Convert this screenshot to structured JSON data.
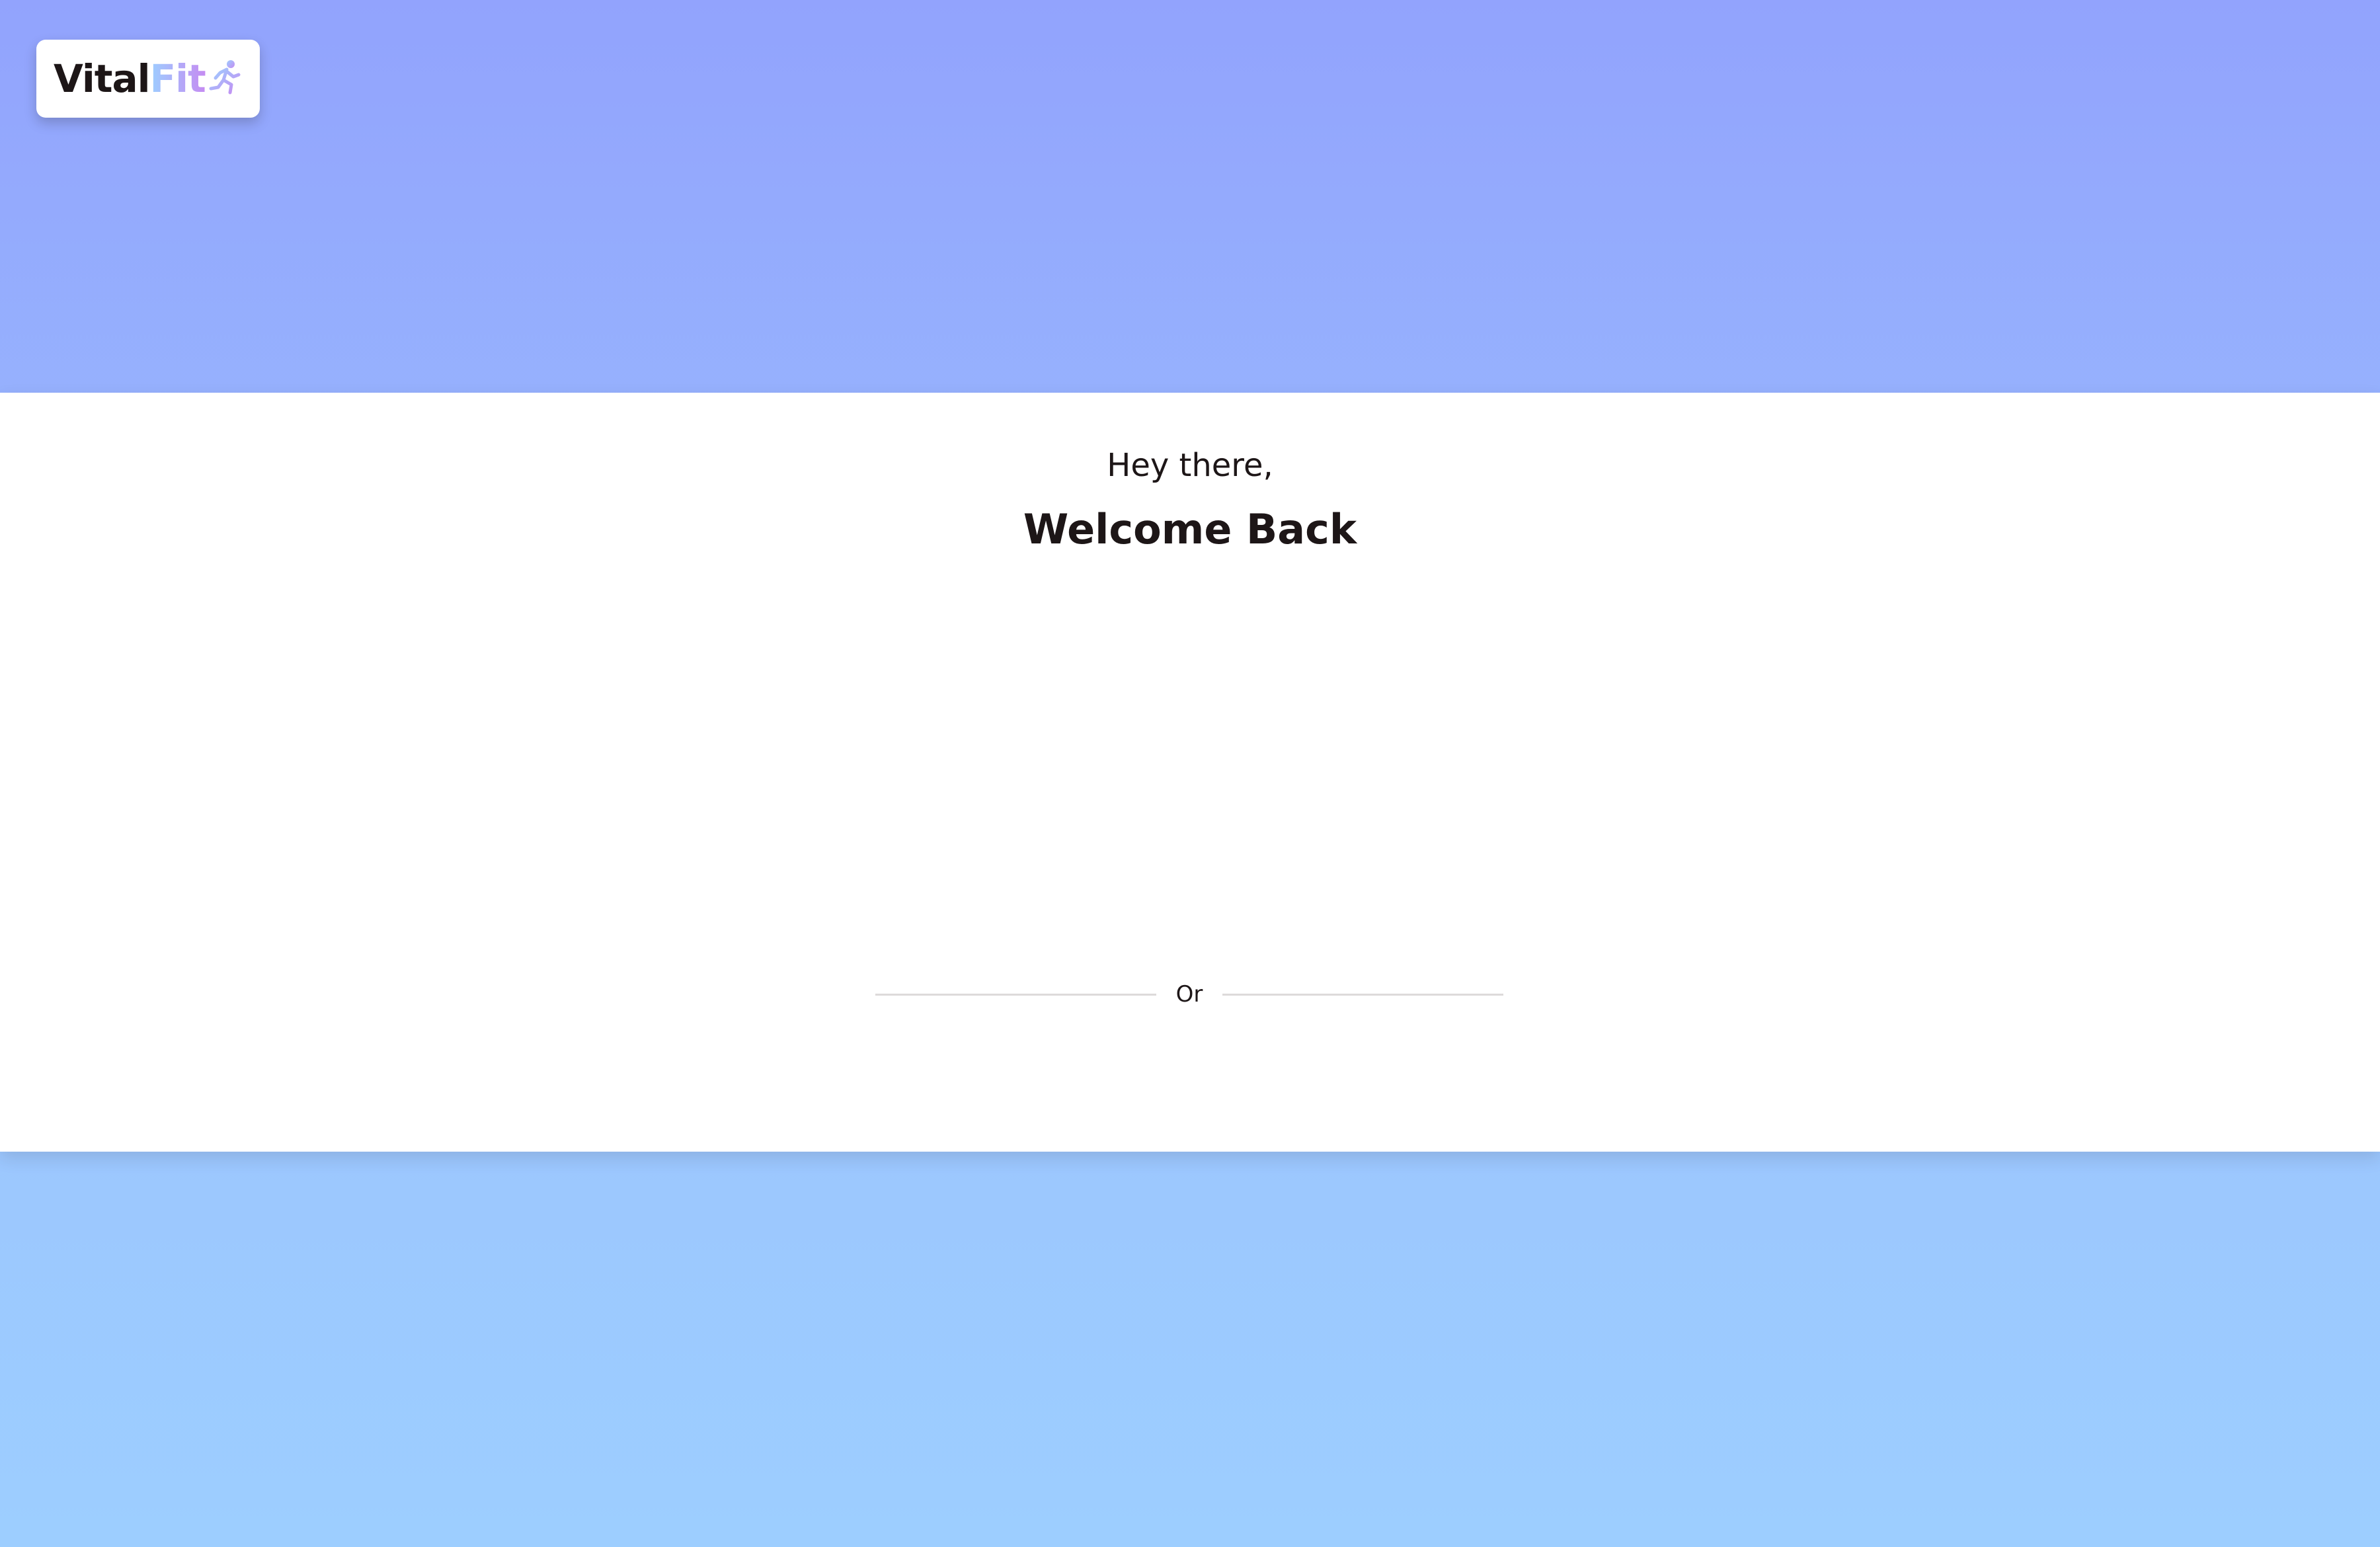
{
  "brand": {
    "name_part1": "Vital",
    "name_part2": "Fit",
    "logo_icon": "runner-icon",
    "colors": {
      "dark": "#1D1617",
      "gradient_start": "#9DCEFF",
      "gradient_end": "#C58BF2"
    }
  },
  "header": {
    "greeting": "Hey there,",
    "title": "Welcome Back"
  },
  "divider": {
    "label": "Or"
  },
  "background": {
    "gradient_top": "#92A3FD",
    "gradient_bottom": "#9DCEFF"
  }
}
